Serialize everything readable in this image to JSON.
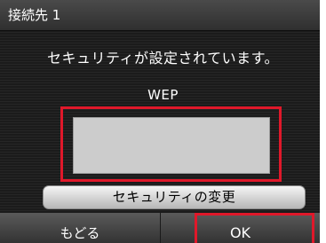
{
  "title_bar": {
    "title": "接続先 1"
  },
  "message": "セキュリティが設定されています。",
  "security_type": "WEP",
  "key_field": {
    "value": ""
  },
  "change_security_button": "セキュリティの変更",
  "bottom_bar": {
    "back_label": "もどる",
    "ok_label": "OK"
  },
  "colors": {
    "highlight": "#e0182a",
    "field_background": "#cccccc",
    "screen_background": "#1e1e1e"
  }
}
